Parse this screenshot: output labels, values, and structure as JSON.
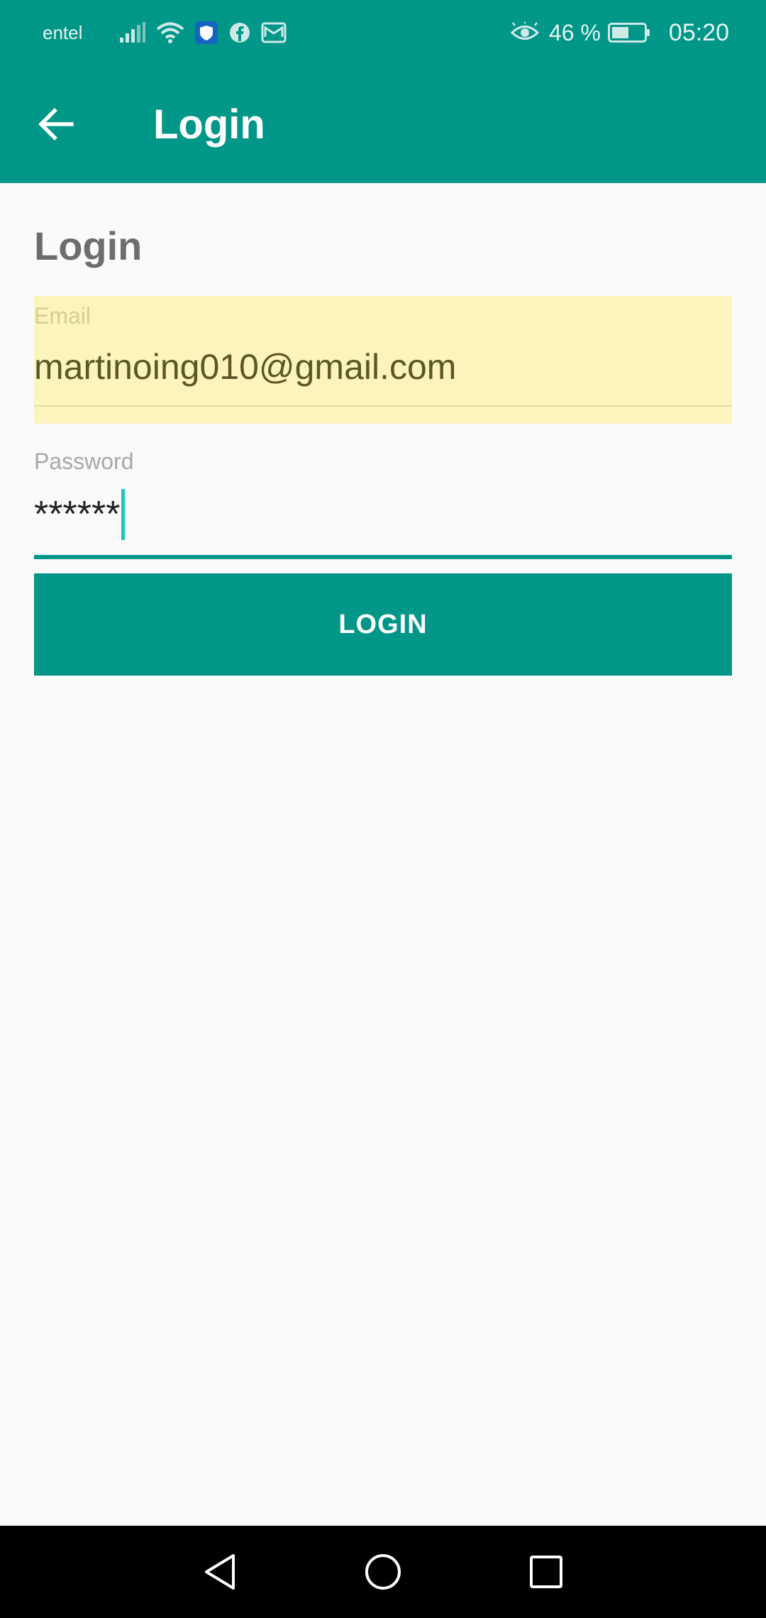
{
  "status_bar": {
    "carrier": "entel",
    "battery_percent": "46 %",
    "time": "05:20",
    "icons": [
      "signal-icon",
      "wifi-icon",
      "shield-app-icon",
      "facebook-icon",
      "mail-icon",
      "eye-icon",
      "battery-icon"
    ]
  },
  "app_bar": {
    "title": "Login"
  },
  "form": {
    "heading": "Login",
    "email_label": "Email",
    "email_value": "martinoing010@gmail.com",
    "password_label": "Password",
    "password_value": "******",
    "login_button": "LOGIN"
  },
  "colors": {
    "primary": "#009688",
    "autofill_bg": "#fcf4bd",
    "accent_caret": "#1cc6b4",
    "background": "#fafafa"
  },
  "nav_bar": {
    "buttons": [
      "back-nav-icon",
      "home-nav-icon",
      "recents-nav-icon"
    ]
  }
}
